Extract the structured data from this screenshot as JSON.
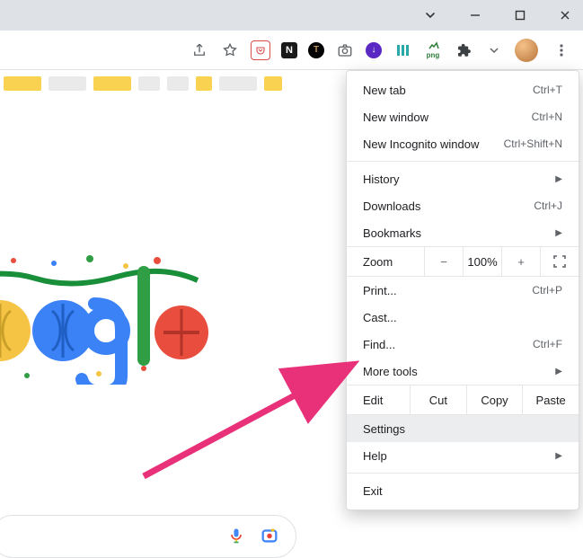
{
  "window_controls": {
    "dropdown": "⌄"
  },
  "menu": {
    "new_tab": {
      "label": "New tab",
      "accel": "Ctrl+T"
    },
    "new_window": {
      "label": "New window",
      "accel": "Ctrl+N"
    },
    "new_incognito": {
      "label": "New Incognito window",
      "accel": "Ctrl+Shift+N"
    },
    "history": {
      "label": "History"
    },
    "downloads": {
      "label": "Downloads",
      "accel": "Ctrl+J"
    },
    "bookmarks": {
      "label": "Bookmarks"
    },
    "zoom": {
      "label": "Zoom",
      "minus": "−",
      "value": "100%",
      "plus": "+"
    },
    "print": {
      "label": "Print...",
      "accel": "Ctrl+P"
    },
    "cast": {
      "label": "Cast..."
    },
    "find": {
      "label": "Find...",
      "accel": "Ctrl+F"
    },
    "more_tools": {
      "label": "More tools"
    },
    "edit": {
      "label": "Edit",
      "cut": "Cut",
      "copy": "Copy",
      "paste": "Paste"
    },
    "settings": {
      "label": "Settings"
    },
    "help": {
      "label": "Help"
    },
    "exit": {
      "label": "Exit"
    }
  },
  "ext": {
    "n": "N",
    "t": "T",
    "png": "png",
    "dl": "↓"
  }
}
